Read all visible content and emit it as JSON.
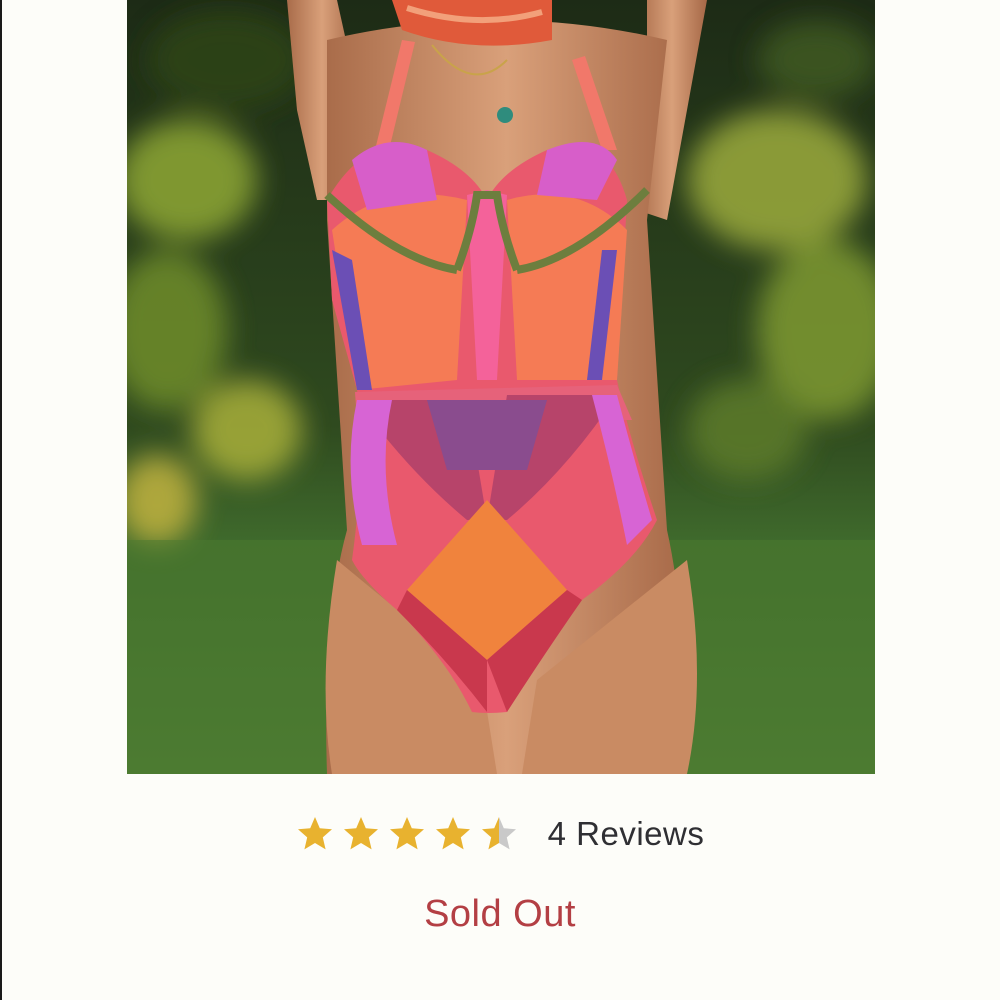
{
  "product": {
    "image_alt": "Woman wearing a multicolor geometric print underwire one-piece swimsuit outdoors",
    "rating": {
      "value": 4.5,
      "max": 5,
      "filled_color": "#e8b22f",
      "empty_color": "#c9c9c9",
      "reviews_label": "4 Reviews"
    },
    "status_label": "Sold Out",
    "status_color": "#b33f44"
  }
}
